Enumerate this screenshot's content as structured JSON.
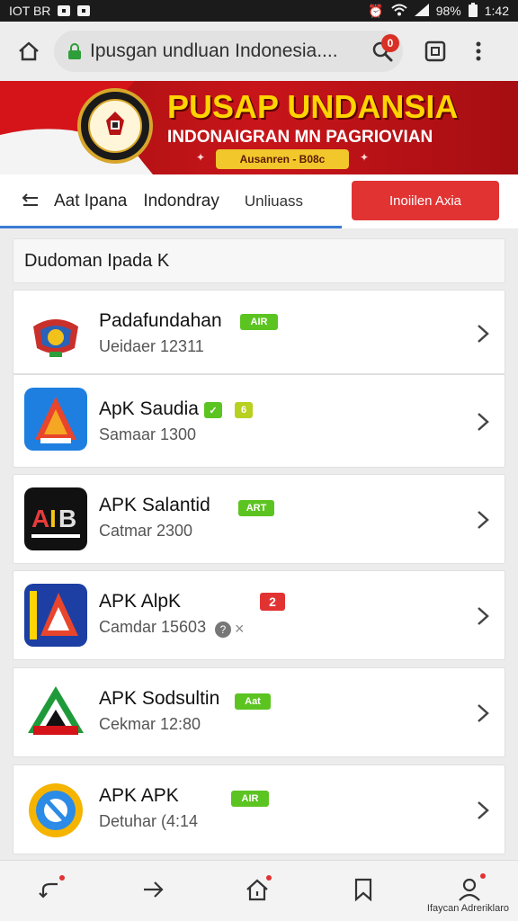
{
  "status_bar": {
    "left_text": "IOT BR",
    "battery": "98%",
    "time": "1:42"
  },
  "browser": {
    "url": "Ipusgan undluan Indonesia....",
    "notification_count": "0"
  },
  "banner": {
    "title": "PUSAP UNDANSIA",
    "subtitle": "INDONAIGRAN MN PAGRIOVIAN",
    "pill": "Ausanren - B08c"
  },
  "nav": {
    "tabs": [
      "Aat Ipana",
      "Indondray",
      "Unliuass"
    ],
    "cta": "Inoiilen Axia"
  },
  "section": {
    "title": "Dudoman Ipada K"
  },
  "apps": [
    {
      "name": "Padafundahan",
      "meta": "Ueidaer 12311",
      "badge": "AIR"
    },
    {
      "name": "ApK Saudia",
      "meta": "Samaar 1300",
      "badge": "6"
    },
    {
      "name": "APK Salantid",
      "meta": "Catmar 2300",
      "badge": "ART"
    },
    {
      "name": "APK AlpK",
      "meta": "Camdar 15603",
      "badge": "2"
    },
    {
      "name": "APK Sodsultin",
      "meta": "Cekmar 12:80",
      "badge": "Aat"
    },
    {
      "name": "APK APK",
      "meta": "Detuhar (4:14",
      "badge": "AIR"
    }
  ],
  "bottom_nav": {
    "caption": "Ifaycan Adreriklaro"
  },
  "colors": {
    "banner_red": "#c8151a",
    "banner_gold": "#ffd400",
    "cta_red": "#e23333",
    "badge_green": "#5cc421",
    "nav_blue": "#3a7bd5"
  }
}
